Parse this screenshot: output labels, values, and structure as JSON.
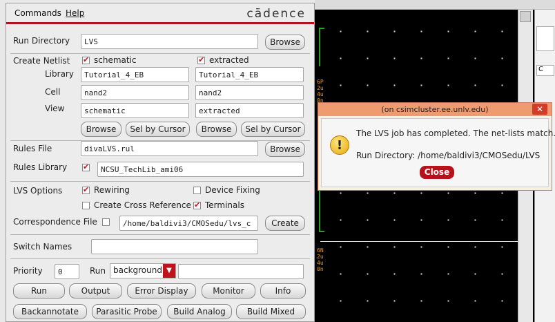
{
  "menu": {
    "commands": "Commands",
    "help": "Help",
    "logo": "cādence"
  },
  "run_directory": {
    "label": "Run Directory",
    "value": "LVS",
    "browse": "Browse"
  },
  "netlist": {
    "label": "Create Netlist",
    "left": {
      "check_label": "schematic",
      "checked": true,
      "library": "Tutorial_4_EB",
      "cell": "nand2",
      "view": "schematic",
      "browse": "Browse",
      "sel_by_cursor": "Sel by Cursor"
    },
    "right": {
      "check_label": "extracted",
      "checked": true,
      "library": "Tutorial_4_EB",
      "cell": "nand2",
      "view": "extracted",
      "browse": "Browse",
      "sel_by_cursor": "Sel by Cursor"
    },
    "library_label": "Library",
    "cell_label": "Cell",
    "view_label": "View"
  },
  "rules_file": {
    "label": "Rules File",
    "value": "divaLVS.rul",
    "browse": "Browse"
  },
  "rules_library": {
    "label": "Rules Library",
    "value": "NCSU_TechLib_ami06",
    "checked": true
  },
  "lvs_options": {
    "label": "LVS Options",
    "rewiring": "Rewiring",
    "rewiring_checked": true,
    "device_fixing": "Device Fixing",
    "device_fixing_checked": false,
    "cross_reference": "Create Cross Reference",
    "cross_reference_checked": false,
    "terminals": "Terminals",
    "terminals_checked": true
  },
  "correspondence": {
    "label": "Correspondence File",
    "value": "/home/baldivi3/CMOSedu/lvs_c",
    "create": "Create",
    "checked": false
  },
  "switch_names": {
    "label": "Switch Names",
    "value": ""
  },
  "priority": {
    "label": "Priority",
    "value": "0",
    "run_label": "Run",
    "run_mode": "background",
    "run_extra": ""
  },
  "buttons_row1": [
    "Run",
    "Output",
    "Error Display",
    "Monitor",
    "Info"
  ],
  "buttons_row2": [
    "Backannotate",
    "Parasitic Probe",
    "Build Analog",
    "Build Mixed"
  ],
  "dialog": {
    "title": "(on csimcluster.ee.unlv.edu)",
    "message": "The LVS job has completed. The net-lists match.",
    "run_dir": "Run Directory: /home/baldivi3/CMOSedu/LVS",
    "close": "Close"
  },
  "background": {
    "labels": [
      "6P",
      "2u",
      "4u",
      "0n",
      "6N",
      "2u",
      "4u",
      "0n"
    ],
    "right_cells": [
      "C"
    ]
  },
  "colors": {
    "accent": "#b3121c",
    "dialog_title": "#f09a70"
  }
}
